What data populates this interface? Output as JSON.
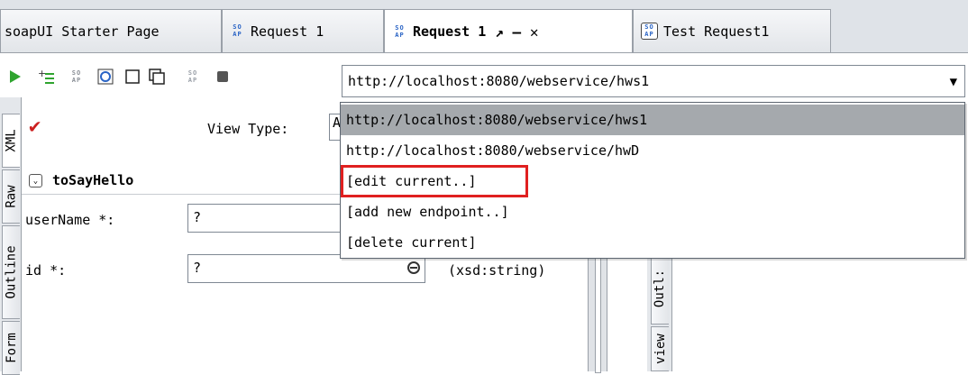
{
  "tabs": [
    {
      "label": "soapUI Starter Page",
      "icon": null
    },
    {
      "label": "Request 1",
      "icon": "soap-icon"
    },
    {
      "label": "Request 1",
      "icon": "soap-icon",
      "active": true,
      "controls": "↗ – ✕"
    },
    {
      "label": "Test Request1",
      "icon": "soap-test-icon"
    }
  ],
  "endpoint": {
    "current": "http://localhost:8080/webservice/hws1",
    "options": [
      "http://localhost:8080/webservice/hws1",
      "http://localhost:8080/webservice/hwD",
      "[edit current..]",
      "[add new endpoint..]",
      "[delete current]"
    ]
  },
  "left_vertical_tabs": [
    "XML",
    "Raw",
    "Outline",
    "Form"
  ],
  "right_vertical_tabs": [
    "Outl:",
    "view"
  ],
  "editor": {
    "view_type_label": "View Type:",
    "view_type_value": "A",
    "operation": "toSayHello",
    "fields": [
      {
        "label": "userName *:",
        "value": "?"
      },
      {
        "label": "id *:",
        "value": "?",
        "type_hint": "(xsd:string)"
      }
    ]
  },
  "colors": {
    "highlight": "#e02020",
    "selected_item": "#a5a9ad",
    "run_icon": "#2fa42f"
  }
}
